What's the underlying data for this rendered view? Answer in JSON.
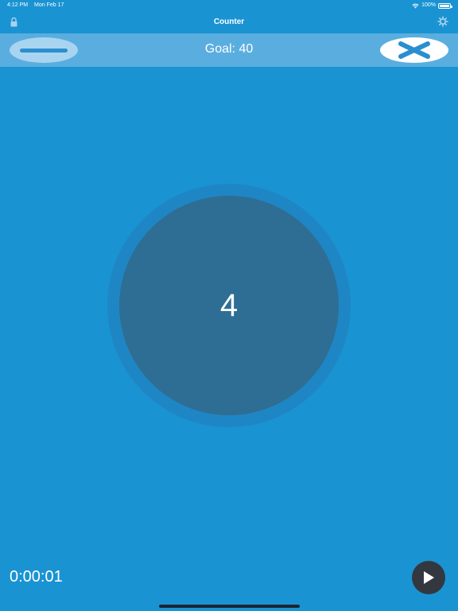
{
  "status_bar": {
    "time": "4:12 PM",
    "date": "Mon Feb 17",
    "battery": "100%",
    "icons": [
      "wifi-icon",
      "battery-icon"
    ]
  },
  "header": {
    "title": "Counter",
    "left_icon": "lock-icon",
    "right_icon": "gear-icon"
  },
  "toolbar": {
    "goal_label": "Goal: 40",
    "decrement_icon": "minus-icon",
    "reset_icon": "close-icon"
  },
  "counter": {
    "value": "4"
  },
  "footer": {
    "timer": "0:00:01",
    "play_icon": "play-icon"
  },
  "colors": {
    "background": "#1a93d3",
    "toolbar": "#5aaedf",
    "counter_ring": "#1f86c5",
    "counter_fill": "#2e6e94",
    "play_button": "#333840"
  }
}
